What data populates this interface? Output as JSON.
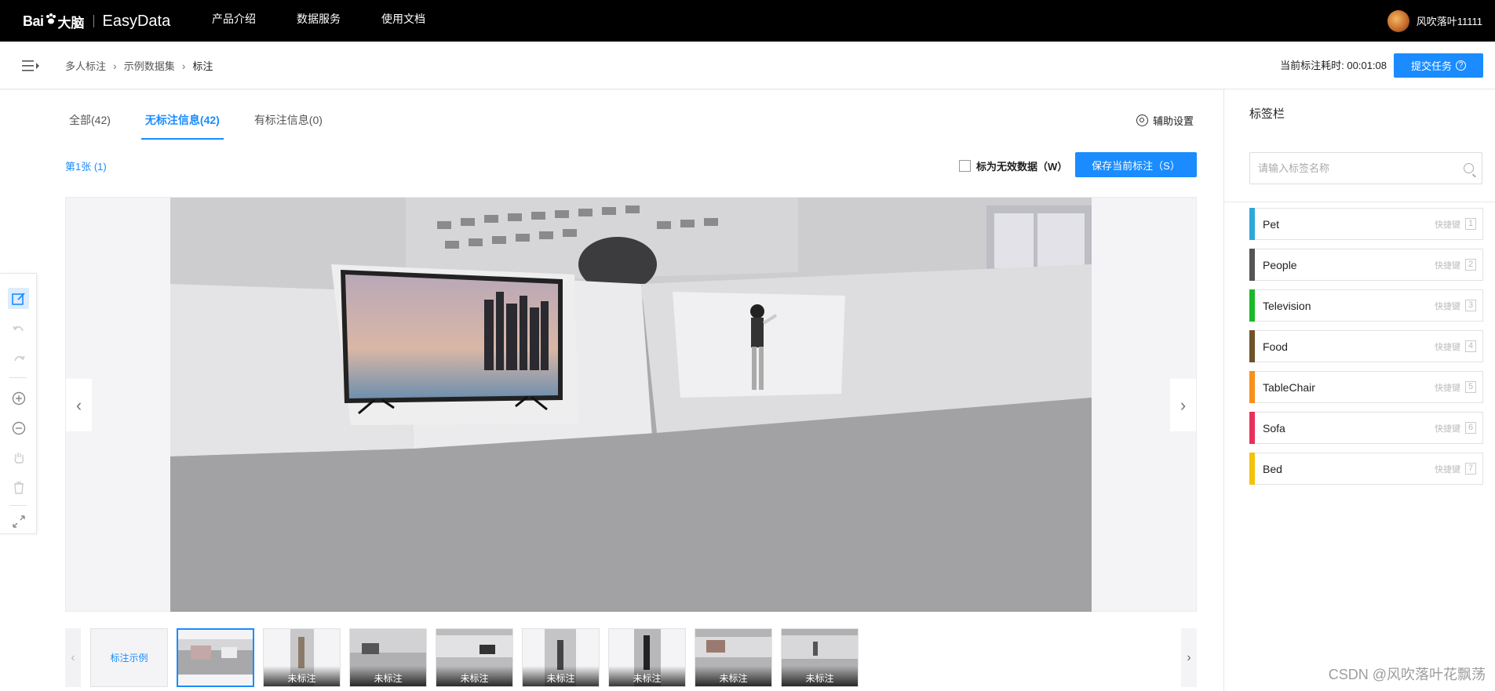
{
  "topbar": {
    "logo_bai": "Bai",
    "logo_dn": "大脑",
    "logo_product": "EasyData",
    "nav": [
      "产品介绍",
      "数据服务",
      "使用文档"
    ],
    "username": "风吹落叶11111"
  },
  "subbar": {
    "breadcrumbs": [
      "多人标注",
      "示例数据集",
      "标注"
    ],
    "timer_label": "当前标注耗时:",
    "timer_value": "00:01:08",
    "submit_label": "提交任务"
  },
  "tabs": [
    {
      "label": "全部(42)",
      "active": false
    },
    {
      "label": "无标注信息(42)",
      "active": true
    },
    {
      "label": "有标注信息(0)",
      "active": false
    }
  ],
  "assist_label": "辅助设置",
  "page_count": "第1张 (1)",
  "invalid_label": "标为无效数据（W）",
  "save_label": "保存当前标注（S）",
  "thumbnails": {
    "example_label": "标注示例",
    "unlabeled_caption": "未标注",
    "count_unlabeled": 7
  },
  "label_panel": {
    "title": "标签栏",
    "search_placeholder": "请输入标签名称",
    "hotkey_text": "快捷键",
    "labels": [
      {
        "name": "Pet",
        "color": "#2ea8d8",
        "key": "1"
      },
      {
        "name": "People",
        "color": "#555555",
        "key": "2"
      },
      {
        "name": "Television",
        "color": "#1cb82a",
        "key": "3"
      },
      {
        "name": "Food",
        "color": "#6e5428",
        "key": "4"
      },
      {
        "name": "TableChair",
        "color": "#f5921e",
        "key": "5"
      },
      {
        "name": "Sofa",
        "color": "#e8315a",
        "key": "6"
      },
      {
        "name": "Bed",
        "color": "#f4c20d",
        "key": "7"
      }
    ]
  },
  "watermark": "CSDN @风吹落叶花飘荡",
  "colors": {
    "accent": "#1a8cff",
    "topbar": "#000000"
  }
}
